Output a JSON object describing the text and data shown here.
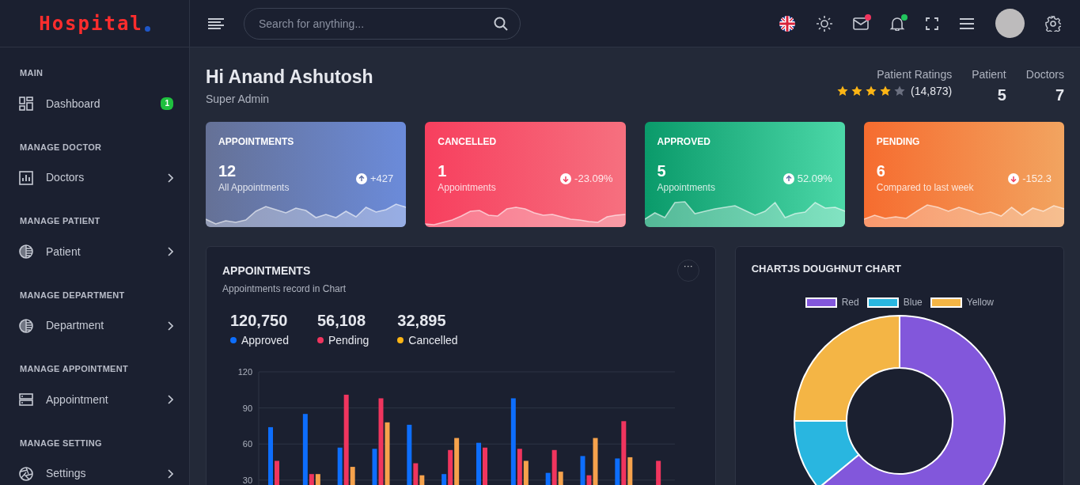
{
  "logo": {
    "text": "Hospital"
  },
  "search": {
    "placeholder": "Search for anything..."
  },
  "sidebar": {
    "sections": [
      {
        "title": "MAIN",
        "items": [
          {
            "label": "Dashboard",
            "badge": "1",
            "expandable": false
          }
        ]
      },
      {
        "title": "MANAGE DOCTOR",
        "items": [
          {
            "label": "Doctors",
            "expandable": true
          }
        ]
      },
      {
        "title": "MANAGE PATIENT",
        "items": [
          {
            "label": "Patient",
            "expandable": true
          }
        ]
      },
      {
        "title": "MANAGE DEPARTMENT",
        "items": [
          {
            "label": "Department",
            "expandable": true
          }
        ]
      },
      {
        "title": "MANAGE APPOINTMENT",
        "items": [
          {
            "label": "Appointment",
            "expandable": true
          }
        ]
      },
      {
        "title": "MANAGE SETTING",
        "items": [
          {
            "label": "Settings",
            "expandable": true
          }
        ]
      }
    ]
  },
  "greeting": {
    "title": "Hi Anand Ashutosh",
    "role": "Super Admin"
  },
  "ratings": {
    "label": "Patient Ratings",
    "stars": 4,
    "count": "(14,873)"
  },
  "counters": [
    {
      "label": "Patient",
      "value": "5"
    },
    {
      "label": "Doctors",
      "value": "7"
    }
  ],
  "stat_cards": [
    {
      "title": "APPOINTMENTS",
      "value": "12",
      "caption": "All Appointments",
      "trend_up": true,
      "change": "+427"
    },
    {
      "title": "CANCELLED",
      "value": "1",
      "caption": "Appointments",
      "trend_up": false,
      "change": "-23.09%"
    },
    {
      "title": "APPROVED",
      "value": "5",
      "caption": "Appointments",
      "trend_up": true,
      "change": "52.09%"
    },
    {
      "title": "PENDING",
      "value": "6",
      "caption": "Compared to last week",
      "trend_up": false,
      "change": "-152.3"
    }
  ],
  "appointments_panel": {
    "title": "APPOINTMENTS",
    "subtitle": "Appointments record in Chart",
    "menu": "···",
    "totals": [
      {
        "value": "120,750",
        "color": "#0d6efd"
      },
      {
        "value": "56,108",
        "color": "#f0355e"
      },
      {
        "value": "32,895",
        "color": "#fdb515"
      }
    ],
    "chart_data": {
      "type": "bar",
      "grid": true,
      "ylim": [
        0,
        120
      ],
      "yticks": [
        30,
        60,
        90,
        120
      ],
      "series": [
        {
          "name": "Approved",
          "color": "#0d6efd",
          "values": [
            74,
            85,
            57,
            56,
            76,
            35,
            61,
            98,
            36,
            50,
            48,
            null
          ]
        },
        {
          "name": "Pending",
          "color": "#f0355e",
          "values": [
            46,
            35,
            101,
            98,
            44,
            55,
            57,
            56,
            55,
            34,
            79,
            46
          ]
        },
        {
          "name": "Cancelled",
          "color": "#f6a24c",
          "values": [
            null,
            35,
            41,
            78,
            34,
            65,
            null,
            46,
            37,
            65,
            49,
            null
          ]
        }
      ]
    }
  },
  "doughnut_panel": {
    "title": "CHARTJS DOUGHNUT CHART",
    "legend": [
      {
        "label": "Red",
        "color": "#8257db"
      },
      {
        "label": "Blue",
        "color": "#29b6e0"
      },
      {
        "label": "Yellow",
        "color": "#f4b545"
      }
    ]
  }
}
